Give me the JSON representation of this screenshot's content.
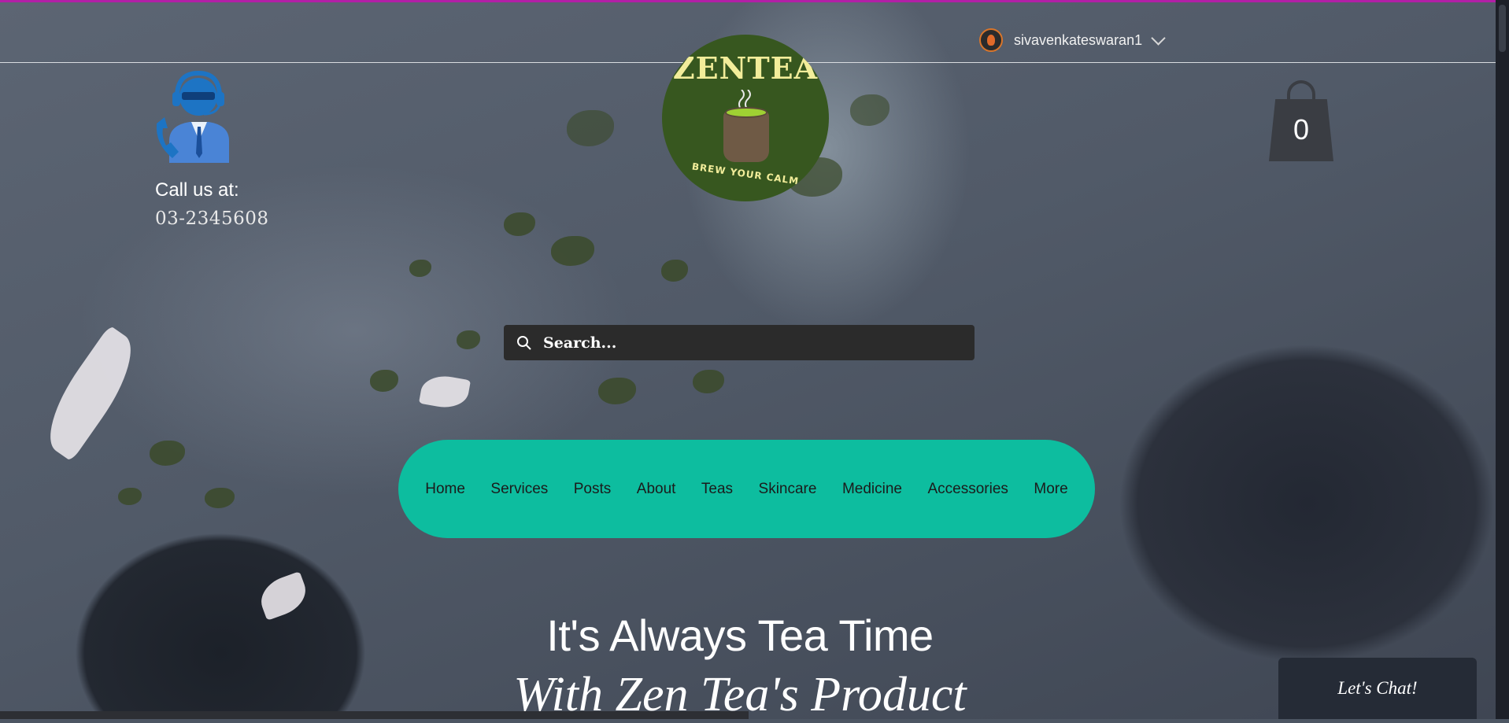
{
  "header": {
    "username": "sivavenkateswaran1",
    "user_avatar_icon": "avatar-icon",
    "user_menu_icon": "chevron-down-icon"
  },
  "contact": {
    "icon": "customer-support-icon",
    "label": "Call us at:",
    "phone": "03-2345608"
  },
  "logo": {
    "title": "ZENTEA",
    "tagline": "BREW YOUR CALM",
    "icon": "tea-cup-icon"
  },
  "cart": {
    "icon": "shopping-bag-icon",
    "count": "0"
  },
  "search": {
    "placeholder": "Search...",
    "icon": "search-icon"
  },
  "nav": {
    "items": [
      "Home",
      "Services",
      "Posts",
      "About",
      "Teas",
      "Skincare",
      "Medicine",
      "Accessories",
      "More"
    ]
  },
  "hero": {
    "line1": "It's Always Tea Time",
    "line2": "With Zen Tea's Product"
  },
  "chat": {
    "label": "Let's Chat!"
  },
  "colors": {
    "nav_bg": "#0dbd9f",
    "logo_bg": "#37571f",
    "accent_line": "#b21fa6",
    "search_bg": "#2b2b2b"
  }
}
